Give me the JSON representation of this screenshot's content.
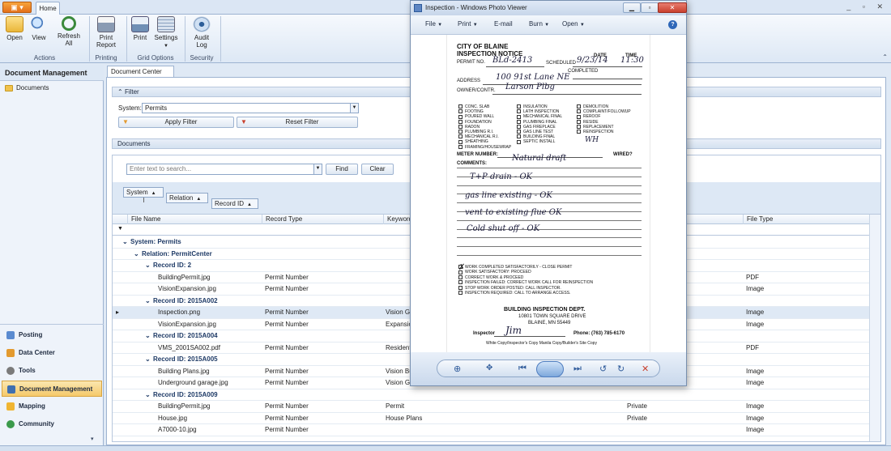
{
  "ribbon": {
    "tab_home": "Home",
    "groups": [
      {
        "name": "Actions",
        "buttons": [
          {
            "label": "Open",
            "icon": "folder-open-icon"
          },
          {
            "label": "View",
            "icon": "magnifier-icon"
          },
          {
            "label": "Refresh All",
            "icon": "refresh-icon"
          }
        ]
      },
      {
        "name": "Printing",
        "buttons": [
          {
            "label": "Print Report",
            "icon": "printer-icon"
          }
        ]
      },
      {
        "name": "Grid Options",
        "buttons": [
          {
            "label": "Print",
            "icon": "print-grid-icon"
          },
          {
            "label": "Settings",
            "icon": "settings-icon"
          }
        ]
      },
      {
        "name": "Security",
        "buttons": [
          {
            "label": "Audit Log",
            "icon": "audit-log-icon"
          }
        ]
      }
    ]
  },
  "left_panel": {
    "title": "Document Management",
    "folder": "Documents",
    "nav": [
      "Posting",
      "Data Center",
      "Tools",
      "Document Management",
      "Mapping",
      "Community"
    ]
  },
  "content": {
    "tab": "Document Center",
    "filter": {
      "title": "Filter",
      "system_label": "System:",
      "system_value": "Permits",
      "apply": "Apply Filter",
      "reset": "Reset Filter"
    },
    "documents": {
      "title": "Documents",
      "search_placeholder": "Enter text to search...",
      "find": "Find",
      "clear": "Clear",
      "group_chips": [
        "System",
        "Relation",
        "Record ID"
      ],
      "columns": [
        "File Name",
        "Record Type",
        "Keyword",
        "File Type"
      ],
      "rows": [
        {
          "kind": "group",
          "level": 0,
          "text": "System: Permits"
        },
        {
          "kind": "group",
          "level": 1,
          "text": "Relation: PermitCenter"
        },
        {
          "kind": "group",
          "level": 2,
          "text": "Record ID: 2"
        },
        {
          "kind": "data",
          "file": "BuildingPermit.jpg",
          "type": "Permit Number",
          "keyword": "",
          "access": "",
          "filetype": "PDF"
        },
        {
          "kind": "data",
          "file": "VisionExpansion.jpg",
          "type": "Permit Number",
          "keyword": "",
          "access": "",
          "filetype": "Image"
        },
        {
          "kind": "group",
          "level": 2,
          "text": "Record ID: 2015A002"
        },
        {
          "kind": "data",
          "file": "Inspection.png",
          "type": "Permit Number",
          "keyword": "Vision Garage",
          "access": "",
          "filetype": "Image",
          "selected": true
        },
        {
          "kind": "data",
          "file": "VisionExpansion.jpg",
          "type": "Permit Number",
          "keyword": "Expansion",
          "access": "",
          "filetype": "Image"
        },
        {
          "kind": "group",
          "level": 2,
          "text": "Record ID: 2015A004"
        },
        {
          "kind": "data",
          "file": "VMS_2001SA002.pdf",
          "type": "Permit Number",
          "keyword": "Residential",
          "access": "",
          "filetype": "PDF"
        },
        {
          "kind": "group",
          "level": 2,
          "text": "Record ID: 2015A005"
        },
        {
          "kind": "data",
          "file": "Building Plans.jpg",
          "type": "Permit Number",
          "keyword": "Vision Building",
          "access": "",
          "filetype": "Image"
        },
        {
          "kind": "data",
          "file": "Underground garage.jpg",
          "type": "Permit Number",
          "keyword": "Vision Garage Plans",
          "access": "Public",
          "filetype": "Image"
        },
        {
          "kind": "group",
          "level": 2,
          "text": "Record ID: 2015A009"
        },
        {
          "kind": "data",
          "file": "BuildingPermit.jpg",
          "type": "Permit Number",
          "keyword": "Permit",
          "access": "Private",
          "filetype": "Image"
        },
        {
          "kind": "data",
          "file": "House.jpg",
          "type": "Permit Number",
          "keyword": "House Plans",
          "access": "Private",
          "filetype": "Image"
        },
        {
          "kind": "data",
          "file": "A7000-10.jpg",
          "type": "Permit Number",
          "keyword": "",
          "access": "",
          "filetype": "Image"
        }
      ]
    }
  },
  "photo_viewer": {
    "title": "Inspection - Windows Photo Viewer",
    "menu": [
      "File",
      "Print",
      "E-mail",
      "Burn",
      "Open"
    ],
    "doc": {
      "org": "CITY OF BLAINE",
      "heading": "INSPECTION NOTICE",
      "permit_label": "PERMIT NO.",
      "permit_no": "BLd-2413",
      "scheduled_label": "SCHEDULED",
      "date_label": "DATE",
      "date": "9/23/14",
      "time_label": "TIME",
      "time": "11:30",
      "completed_label": "COMPLETED",
      "address_label": "ADDRESS",
      "address": "100 91st Lane NE",
      "owner_label": "OWNER/CONTR.",
      "owner": "Larson Plbg",
      "checks_col1": [
        "CONC. SLAB",
        "FOOTING",
        "POURED WALL",
        "FOUNDATION",
        "RADON",
        "PLUMBING R.I.",
        "MECHANICAL R.I.",
        "SHEATHING",
        "FRAMING/HOUSEWRAP"
      ],
      "checks_col2": [
        "INSULATION",
        "LATH INSPECTION",
        "MECHANICAL FINAL",
        "PLUMBING FINAL",
        "GAS FIREPLACE",
        "GAS LINE TEST",
        "BUILDING FINAL",
        "SEPTIC INSTALL"
      ],
      "checks_col3": [
        "DEMOLITION",
        "COMPLAINT/FOLLOWUP",
        "REROOF",
        "RESIDE",
        "REPLACEMENT",
        "REINSPECTION"
      ],
      "handwritten_check": "WH",
      "meter_label": "METER NUMBER:",
      "wired_label": "WIRED?",
      "comments_label": "COMMENTS:",
      "comments": [
        "Natural draft",
        "T+P drain - OK",
        "gas line existing - OK",
        "vent to existing flue  OK",
        "Cold shut off - OK"
      ],
      "results": [
        "WORK COMPLETED SATISFACTORILY - CLOSE PERMIT",
        "WORK SATISFACTORY: PROCEED",
        "CORRECT WORK & PROCEED",
        "INSPECTION FAILED:   CORRECT WORK   CALL FOR REINSPECTION",
        "STOP WORK ORDER POSTED: CALL INSPECTOR.",
        "INSPECTION REQUIRED: CALL TO ARRANGE ACCESS."
      ],
      "dept": "BUILDING INSPECTION DEPT.",
      "dept_addr": "10801 TOWN SQUARE DRIVE",
      "dept_city": "BLAINE, MN 55449",
      "inspector_label": "Inspector",
      "inspector_sig": "Jim",
      "phone": "Phone: (763) 785-6170",
      "footer": "White Copy/Inspector's Copy         Manila Copy/Builder's Site Copy"
    }
  }
}
